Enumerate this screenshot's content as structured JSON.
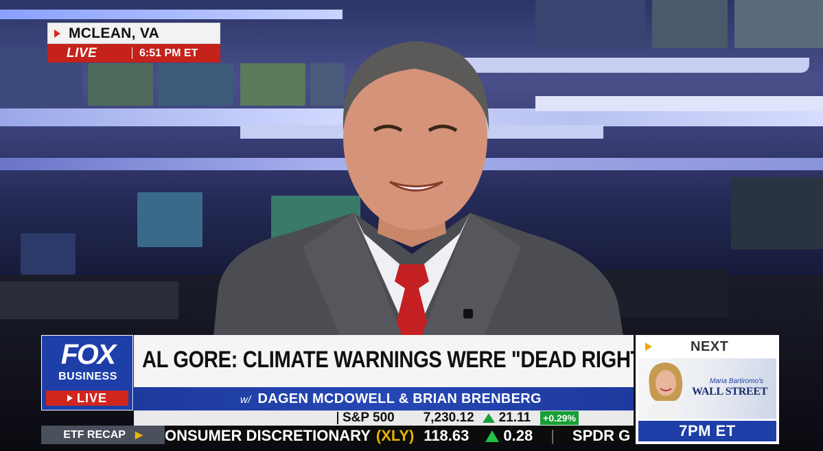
{
  "location_bug": {
    "location": "MCLEAN, VA",
    "live_label": "LIVE",
    "time": "6:51 PM ET"
  },
  "logo": {
    "fox": "FOX",
    "business": "BUSINESS",
    "live_label": "LIVE"
  },
  "headline": "AL GORE: CLIMATE WARNINGS WERE \"DEAD RIGHT\"",
  "hosts": {
    "prefix": "w/",
    "names": "DAGEN MCDOWELL & BRIAN BRENBERG"
  },
  "ticker_top": {
    "index": "S&P 500",
    "value": "7,230.12",
    "change": "21.11",
    "percent": "+0.29%"
  },
  "ticker_bottom": {
    "section": "ETF RECAP",
    "name": "ONSUMER DISCRETIONARY",
    "symbol": "(XLY)",
    "price": "118.63",
    "change": "0.28",
    "next_item": "SPDR G"
  },
  "next_panel": {
    "label": "NEXT",
    "show_line1": "Maria Bartiromo's",
    "show_line2": "WALL STREET",
    "time": "7PM ET"
  },
  "colors": {
    "fox_blue": "#1e3fa8",
    "live_red": "#c4221a",
    "up_green": "#19a23a",
    "symbol_yellow": "#e8b400"
  }
}
